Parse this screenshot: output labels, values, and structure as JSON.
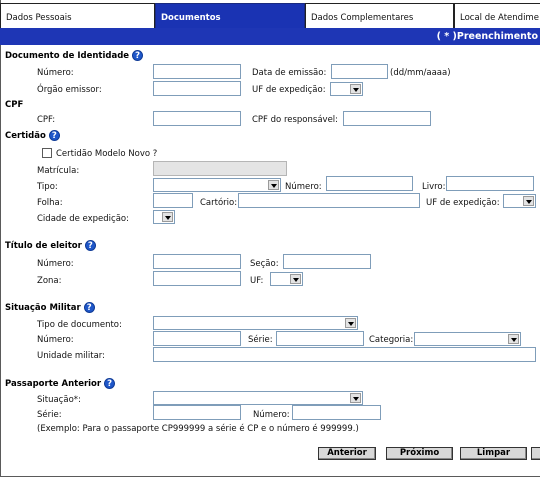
{
  "tabs": [
    {
      "label": "Dados Pessoais"
    },
    {
      "label": "Documentos"
    },
    {
      "label": "Dados Complementares"
    },
    {
      "label": "Local de Atendime"
    }
  ],
  "banner": "( * )Preenchimento",
  "help_glyph": "?",
  "identidade": {
    "title": "Documento de Identidade",
    "numero_label": "Número:",
    "data_emissao_label": "Data de emissão:",
    "data_hint": "(dd/mm/aaaa)",
    "orgao_label": "Órgão emissor:",
    "uf_label": "UF de expedição:"
  },
  "cpf": {
    "title": "CPF",
    "cpf_label": "CPF:",
    "responsavel_label": "CPF do responsável:"
  },
  "certidao": {
    "title": "Certidão",
    "modelo_novo_label": "Certidão Modelo Novo ?",
    "matricula_label": "Matrícula:",
    "tipo_label": "Tipo:",
    "numero_label": "Número:",
    "livro_label": "Livro:",
    "folha_label": "Folha:",
    "cartorio_label": "Cartório:",
    "uf_label": "UF de expedição:",
    "cidade_label": "Cidade de expedição:"
  },
  "titulo": {
    "title": "Título de eleitor",
    "numero_label": "Número:",
    "secao_label": "Seção:",
    "zona_label": "Zona:",
    "uf_label": "UF:"
  },
  "militar": {
    "title": "Situação Militar",
    "tipo_label": "Tipo de documento:",
    "numero_label": "Número:",
    "serie_label": "Série:",
    "categoria_label": "Categoria:",
    "unidade_label": "Unidade militar:"
  },
  "passaporte": {
    "title": "Passaporte Anterior",
    "situacao_label": "Situação*:",
    "serie_label": "Série:",
    "numero_label": "Número:",
    "example": "(Exemplo: Para o passaporte CP999999 a série é CP e o número é 999999.)"
  },
  "buttons": {
    "anterior": "Anterior",
    "proximo": "Próximo",
    "limpar": "Limpar"
  }
}
